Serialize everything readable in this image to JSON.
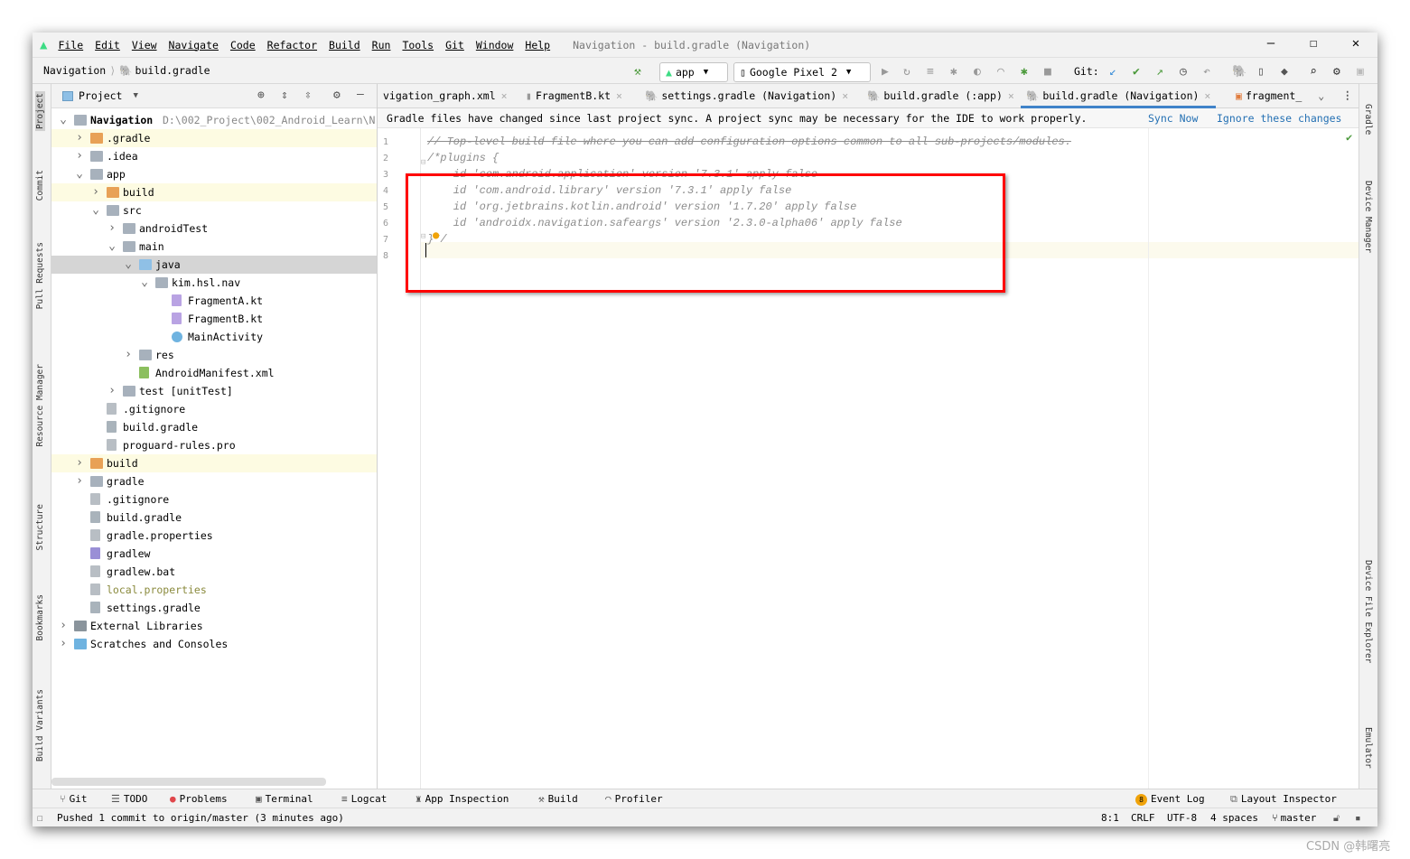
{
  "menu": [
    "File",
    "Edit",
    "View",
    "Navigate",
    "Code",
    "Refactor",
    "Build",
    "Run",
    "Tools",
    "Git",
    "Window",
    "Help"
  ],
  "window_title": "Navigation - build.gradle (Navigation)",
  "breadcrumb": [
    "Navigation",
    "build.gradle"
  ],
  "run_config": "app",
  "device": "Google Pixel 2",
  "git_label": "Git:",
  "left_tools": [
    "Project",
    "Commit",
    "Pull Requests",
    "Resource Manager",
    "Structure",
    "Bookmarks",
    "Build Variants"
  ],
  "right_tools": [
    "Gradle",
    "Device Manager",
    "Device File Explorer",
    "Emulator"
  ],
  "project_panel": {
    "title": "Project",
    "root_path": "D:\\002_Project\\002_Android_Learn\\N"
  },
  "tree": [
    {
      "label": "Navigation",
      "level": 0,
      "state": "open",
      "icon": "module-folder"
    },
    {
      "label": ".gradle",
      "level": 1,
      "state": "closed",
      "icon": "excluded-folder",
      "hl": true
    },
    {
      "label": ".idea",
      "level": 1,
      "state": "closed",
      "icon": "folder"
    },
    {
      "label": "app",
      "level": 1,
      "state": "open",
      "icon": "module-folder"
    },
    {
      "label": "build",
      "level": 2,
      "state": "closed",
      "icon": "excluded-folder",
      "hl": true
    },
    {
      "label": "src",
      "level": 2,
      "state": "open",
      "icon": "folder"
    },
    {
      "label": "androidTest",
      "level": 3,
      "state": "closed",
      "icon": "folder"
    },
    {
      "label": "main",
      "level": 3,
      "state": "open",
      "icon": "folder"
    },
    {
      "label": "java",
      "level": 4,
      "state": "open",
      "icon": "source-folder",
      "sel": true
    },
    {
      "label": "kim.hsl.nav",
      "level": 5,
      "state": "open",
      "icon": "package"
    },
    {
      "label": "FragmentA.kt",
      "level": 6,
      "icon": "kotlin-file"
    },
    {
      "label": "FragmentB.kt",
      "level": 6,
      "icon": "kotlin-file"
    },
    {
      "label": "MainActivity",
      "level": 6,
      "icon": "kotlin-class"
    },
    {
      "label": "res",
      "level": 4,
      "state": "closed",
      "icon": "folder"
    },
    {
      "label": "AndroidManifest.xml",
      "level": 4,
      "icon": "manifest-file"
    },
    {
      "label": "test [unitTest]",
      "level": 3,
      "state": "closed",
      "icon": "folder"
    },
    {
      "label": ".gitignore",
      "level": 2,
      "icon": "file"
    },
    {
      "label": "build.gradle",
      "level": 2,
      "icon": "gradle-file"
    },
    {
      "label": "proguard-rules.pro",
      "level": 2,
      "icon": "file"
    },
    {
      "label": "build",
      "level": 1,
      "state": "closed",
      "icon": "excluded-folder",
      "hl": true
    },
    {
      "label": "gradle",
      "level": 1,
      "state": "closed",
      "icon": "folder"
    },
    {
      "label": ".gitignore",
      "level": 1,
      "icon": "file"
    },
    {
      "label": "build.gradle",
      "level": 1,
      "icon": "gradle-file"
    },
    {
      "label": "gradle.properties",
      "level": 1,
      "icon": "properties-file"
    },
    {
      "label": "gradlew",
      "level": 1,
      "icon": "script-file"
    },
    {
      "label": "gradlew.bat",
      "level": 1,
      "icon": "file"
    },
    {
      "label": "local.properties",
      "level": 1,
      "icon": "properties-file",
      "olive": true
    },
    {
      "label": "settings.gradle",
      "level": 1,
      "icon": "gradle-file"
    },
    {
      "label": "External Libraries",
      "level": 0,
      "state": "closed",
      "icon": "libraries"
    },
    {
      "label": "Scratches and Consoles",
      "level": 0,
      "state": "closed",
      "icon": "scratches"
    }
  ],
  "tabs": [
    {
      "label": "vigation_graph.xml"
    },
    {
      "label": "FragmentB.kt"
    },
    {
      "label": "settings.gradle (Navigation)"
    },
    {
      "label": "build.gradle (:app)"
    },
    {
      "label": "build.gradle (Navigation)",
      "active": true
    },
    {
      "label": "fragment_"
    }
  ],
  "banner": {
    "text": "Gradle files have changed since last project sync. A project sync may be necessary for the IDE to work properly.",
    "sync": "Sync Now",
    "ignore": "Ignore these changes"
  },
  "code_lines": [
    "// Top-level build file where you can add configuration options common to all sub-projects/modules.",
    "/*plugins {",
    "    id 'com.android.application' version '7.3.1' apply false",
    "    id 'com.android.library' version '7.3.1' apply false",
    "    id 'org.jetbrains.kotlin.android' version '1.7.20' apply false",
    "    id 'androidx.navigation.safeargs' version '2.3.0-alpha06' apply false",
    "}*/",
    ""
  ],
  "bottom_tools": [
    "Git",
    "TODO",
    "Problems",
    "Terminal",
    "Logcat",
    "App Inspection",
    "Build",
    "Profiler"
  ],
  "event_log": {
    "label": "Event Log",
    "count": "8"
  },
  "layout_inspector": "Layout Inspector",
  "status": {
    "message": "Pushed 1 commit to origin/master (3 minutes ago)",
    "position": "8:1",
    "line_sep": "CRLF",
    "encoding": "UTF-8",
    "indent": "4 spaces",
    "branch": "master"
  },
  "watermark": "CSDN @韩曙亮",
  "colors": {
    "accent": "#4083c9",
    "highlight_box": "#ff0000",
    "link": "#2470b3"
  }
}
